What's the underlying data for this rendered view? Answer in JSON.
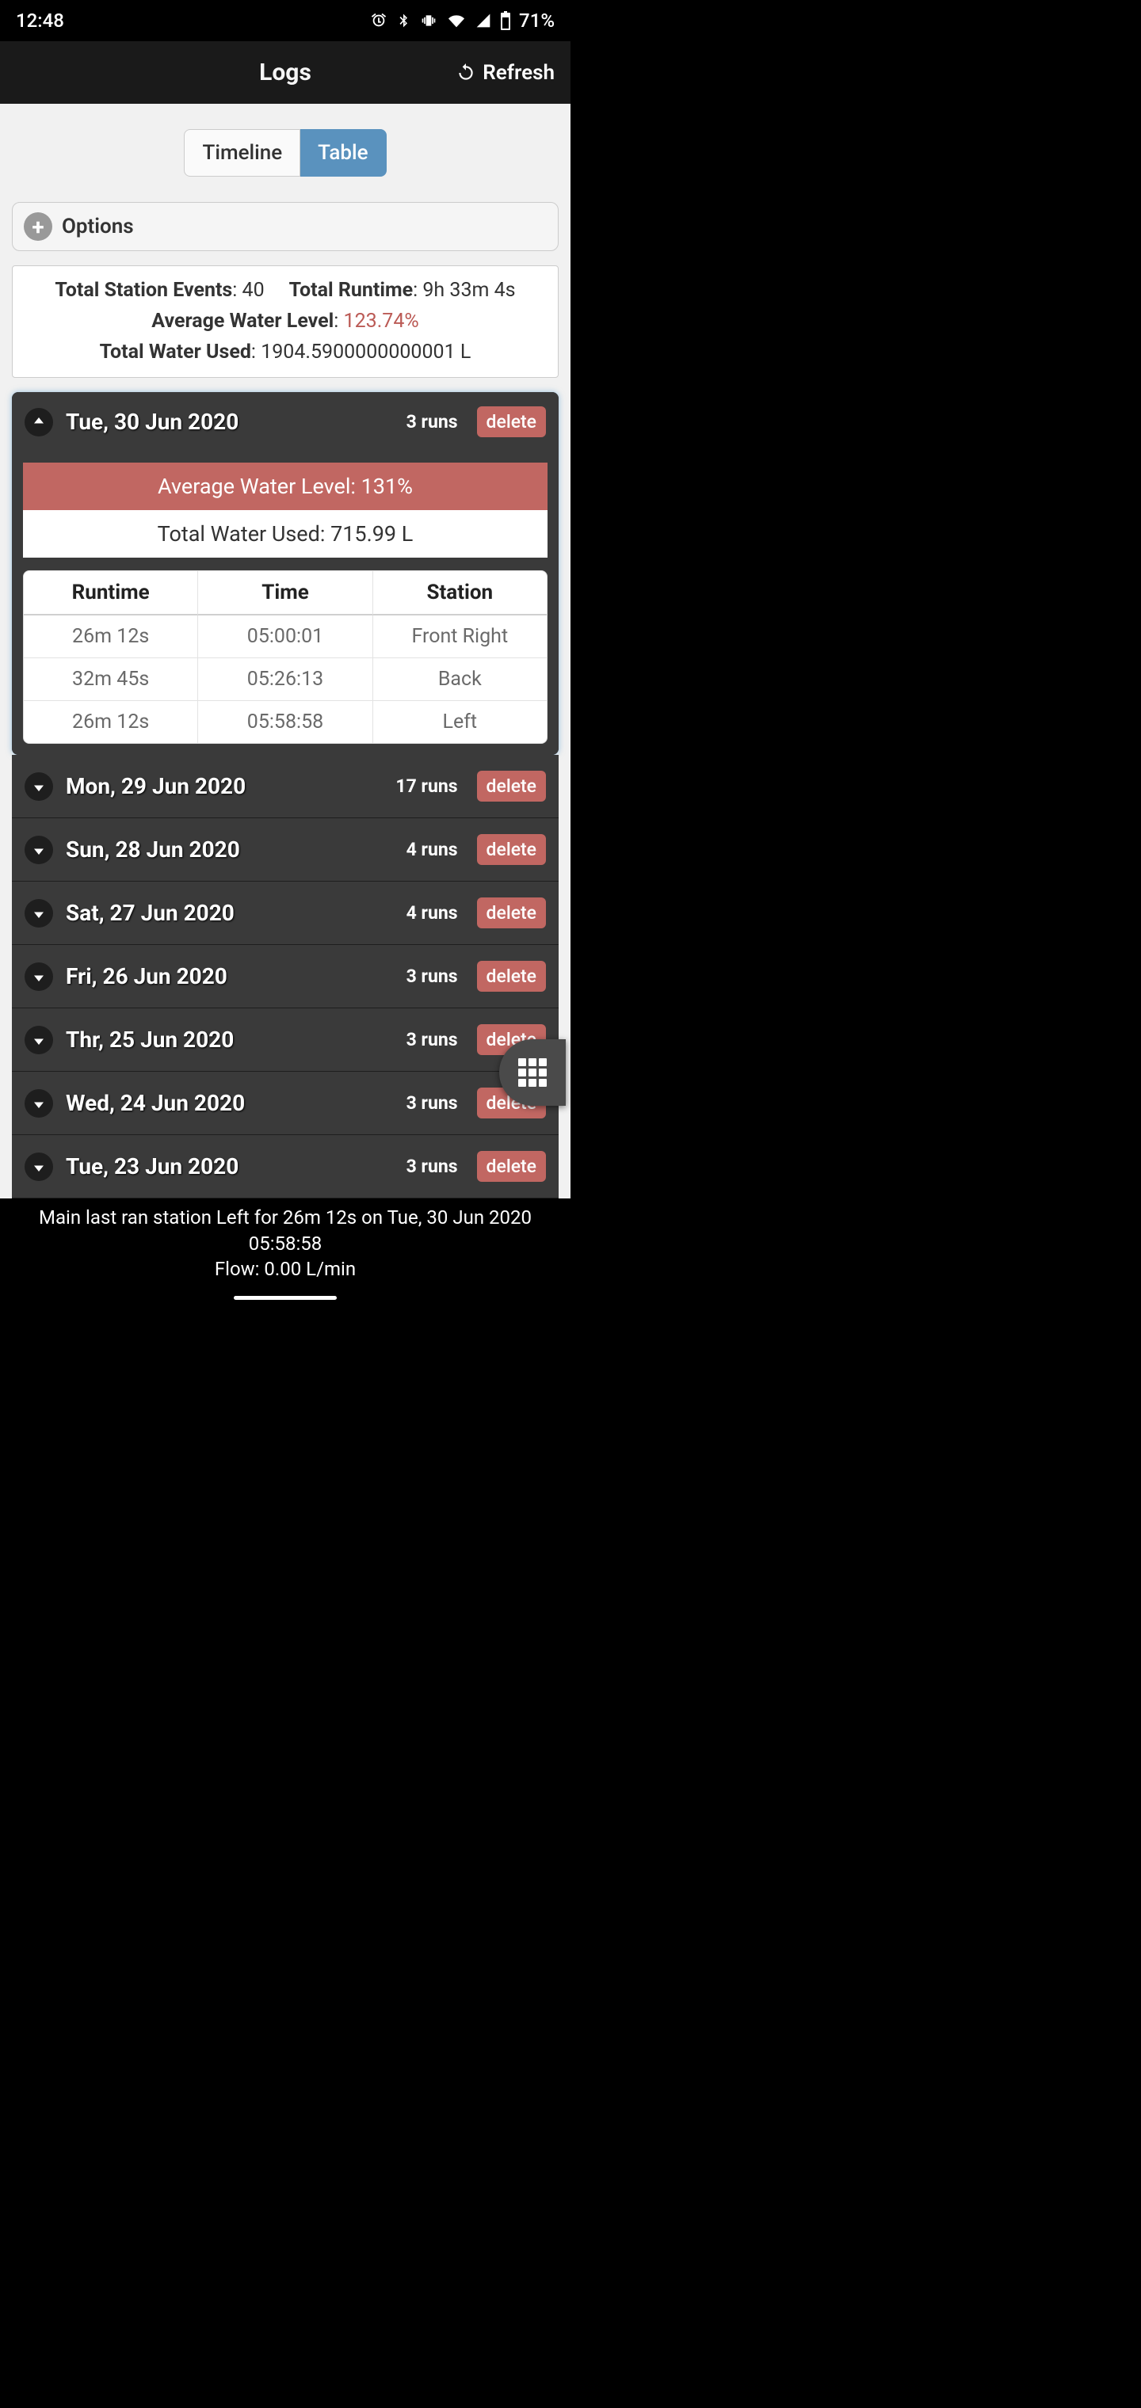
{
  "status": {
    "time": "12:48",
    "battery": "71%"
  },
  "header": {
    "title": "Logs",
    "refresh": "Refresh"
  },
  "tabs": {
    "timeline": "Timeline",
    "table": "Table"
  },
  "options": {
    "label": "Options"
  },
  "summary": {
    "events_label": "Total Station Events",
    "events_value": "40",
    "runtime_label": "Total Runtime",
    "runtime_value": "9h 33m 4s",
    "avg_label": "Average Water Level",
    "avg_value": "123.74%",
    "used_label": "Total Water Used",
    "used_value": "1904.5900000000001 L"
  },
  "expanded": {
    "date": "Tue, 30 Jun 2020",
    "runs": "3 runs",
    "delete": "delete",
    "avg": "Average Water Level: 131%",
    "used": "Total Water Used: 715.99 L",
    "cols": {
      "runtime": "Runtime",
      "time": "Time",
      "station": "Station"
    },
    "rows": [
      {
        "runtime": "26m 12s",
        "time": "05:00:01",
        "station": "Front Right"
      },
      {
        "runtime": "32m 45s",
        "time": "05:26:13",
        "station": "Back"
      },
      {
        "runtime": "26m 12s",
        "time": "05:58:58",
        "station": "Left"
      }
    ]
  },
  "days": [
    {
      "date": "Mon, 29 Jun 2020",
      "runs": "17 runs",
      "delete": "delete"
    },
    {
      "date": "Sun, 28 Jun 2020",
      "runs": "4 runs",
      "delete": "delete"
    },
    {
      "date": "Sat, 27 Jun 2020",
      "runs": "4 runs",
      "delete": "delete"
    },
    {
      "date": "Fri, 26 Jun 2020",
      "runs": "3 runs",
      "delete": "delete"
    },
    {
      "date": "Thr, 25 Jun 2020",
      "runs": "3 runs",
      "delete": "delete"
    },
    {
      "date": "Wed, 24 Jun 2020",
      "runs": "3 runs",
      "delete": "delete"
    },
    {
      "date": "Tue, 23 Jun 2020",
      "runs": "3 runs",
      "delete": "delete"
    }
  ],
  "footer": {
    "line1": "Main last ran station Left for 26m 12s on Tue, 30 Jun 2020 05:58:58",
    "line2": "Flow: 0.00 L/min"
  }
}
